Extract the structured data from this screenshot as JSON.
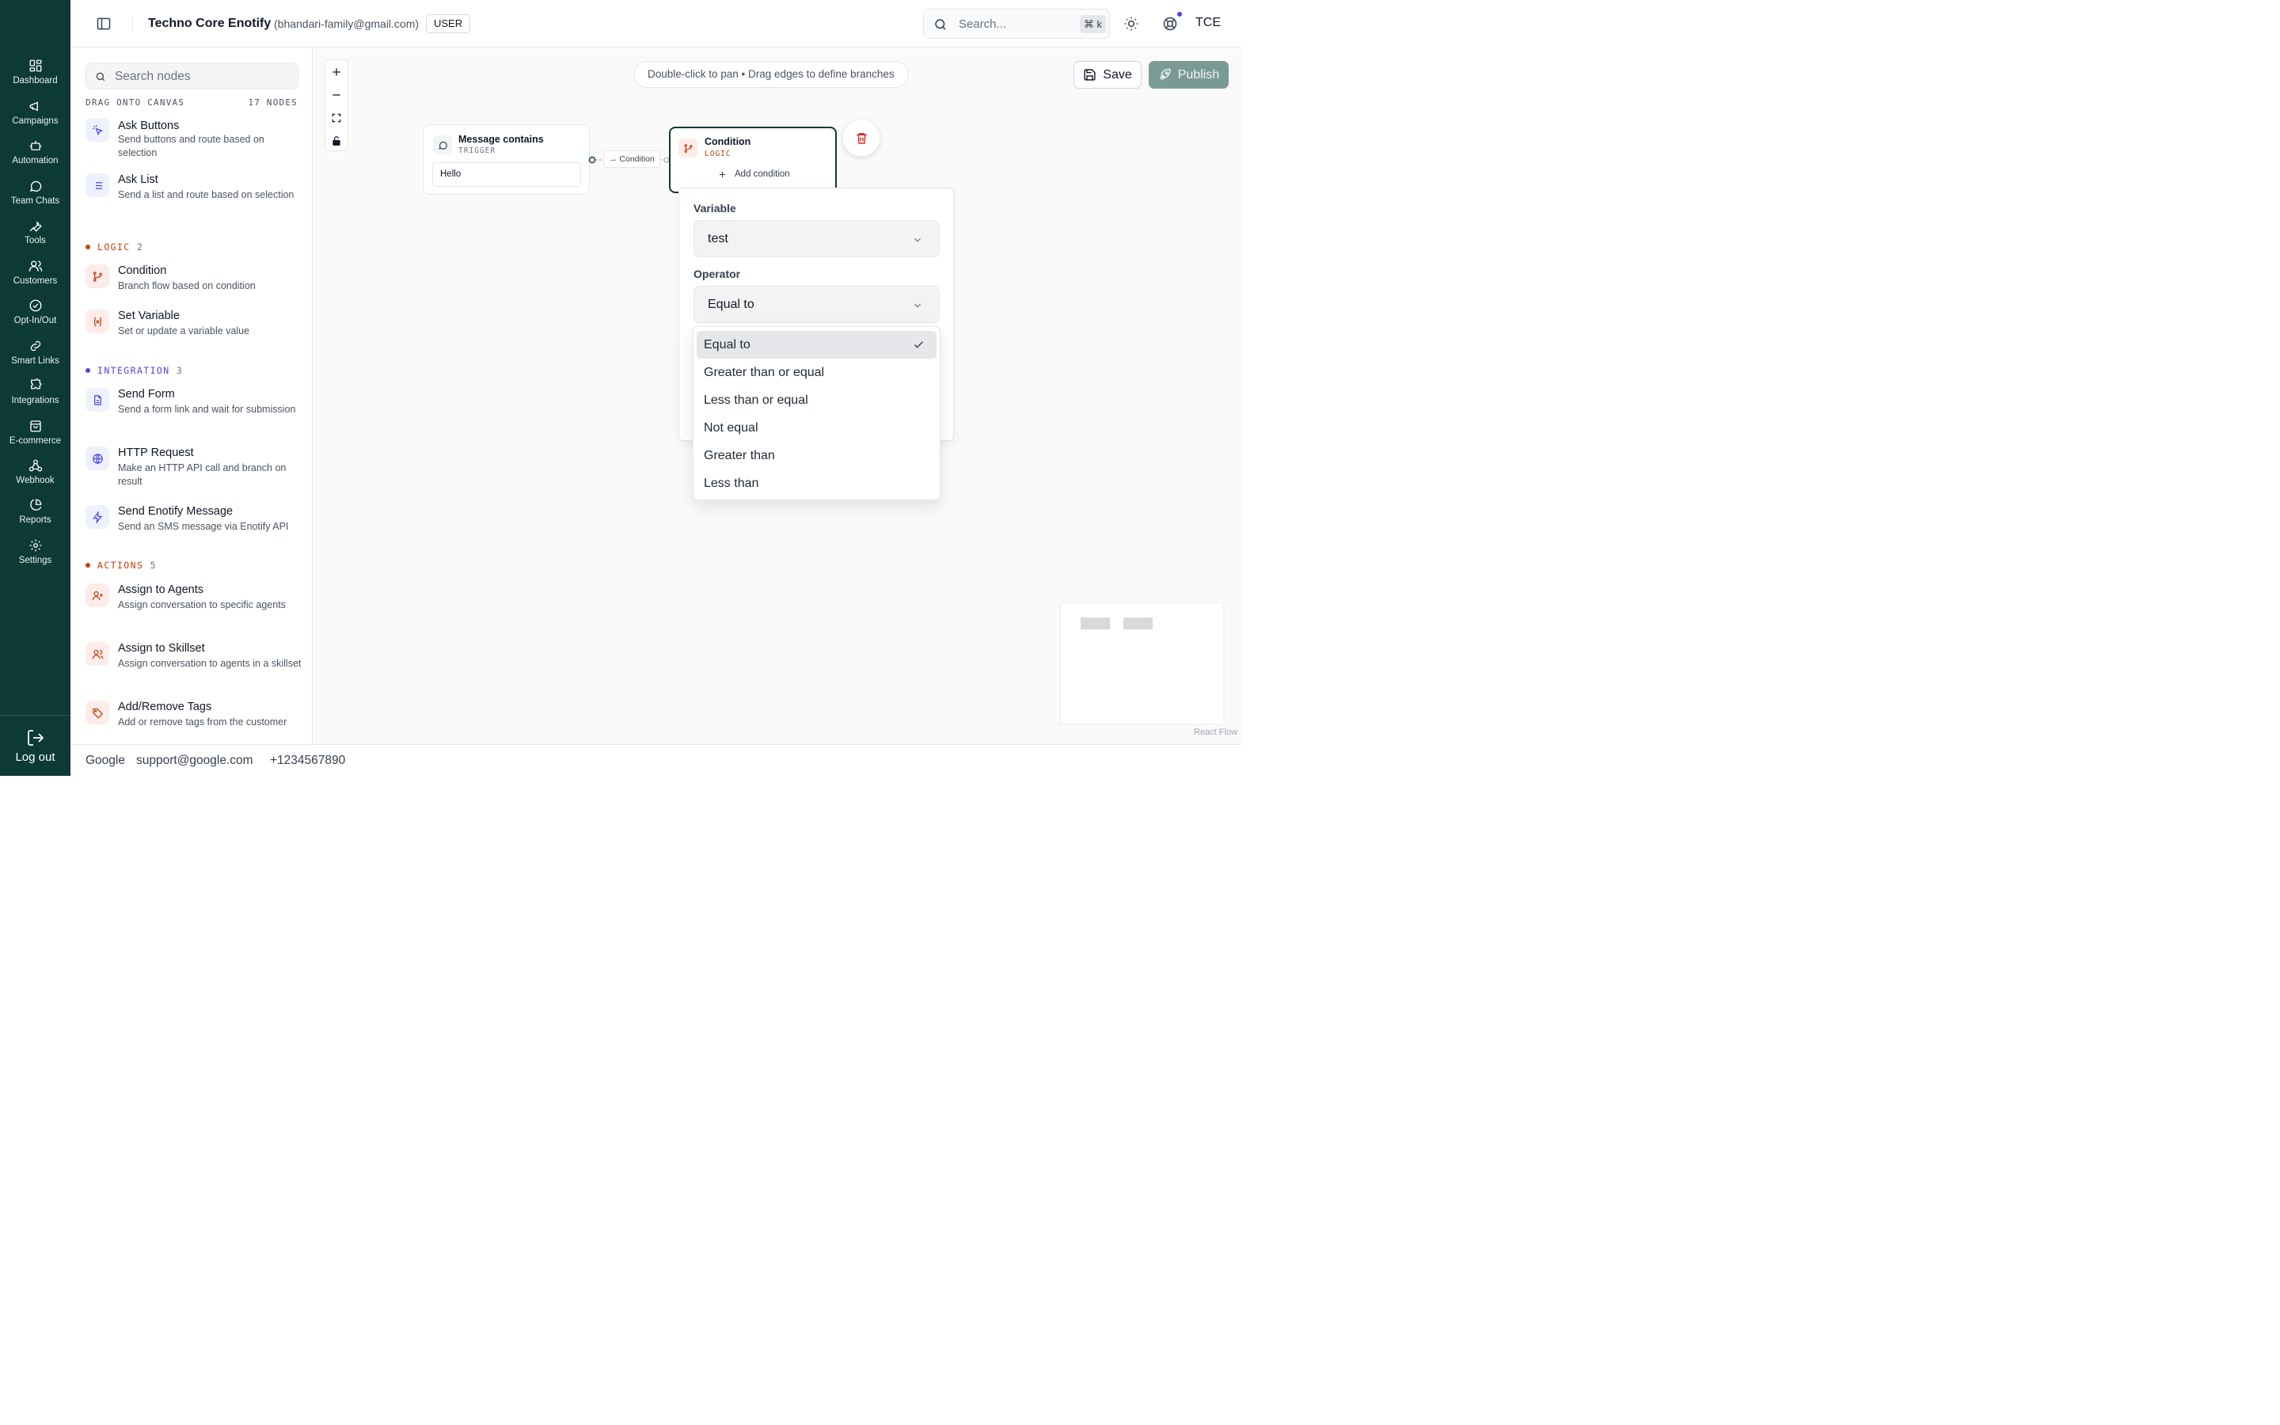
{
  "nav": {
    "items": [
      {
        "label": "Dashboard",
        "icon": "dashboard-icon"
      },
      {
        "label": "Campaigns",
        "icon": "megaphone-icon"
      },
      {
        "label": "Automation",
        "icon": "bot-icon"
      },
      {
        "label": "Team Chats",
        "icon": "chat-icon"
      },
      {
        "label": "Tools",
        "icon": "wrench-icon"
      },
      {
        "label": "Customers",
        "icon": "users-icon"
      },
      {
        "label": "Opt-In/Out",
        "icon": "check-circle-icon"
      },
      {
        "label": "Smart Links",
        "icon": "link-icon"
      },
      {
        "label": "Integrations",
        "icon": "puzzle-icon"
      },
      {
        "label": "E-commerce",
        "icon": "shopping-bag-icon"
      },
      {
        "label": "Webhook",
        "icon": "webhook-icon"
      },
      {
        "label": "Reports",
        "icon": "pie-chart-icon"
      },
      {
        "label": "Settings",
        "icon": "gear-icon"
      }
    ],
    "logout_label": "Log out"
  },
  "header": {
    "org_name": "Techno Core Enotify",
    "org_email": "(bhandari-family@gmail.com)",
    "role": "USER",
    "search_placeholder": "Search...",
    "search_shortcut": "⌘ k",
    "avatar_initials": "TCE"
  },
  "node_panel": {
    "search_placeholder": "Search nodes",
    "drag_hint": "DRAG ONTO CANVAS",
    "node_count": "17 NODES",
    "partial_items": [
      {
        "title": "Ask Buttons",
        "desc": "Send buttons and route based on selection"
      },
      {
        "title": "Ask List",
        "desc": "Send a list and route based on selection"
      }
    ],
    "sections": [
      {
        "title": "LOGIC",
        "count": "2",
        "color": "#c2410c",
        "items": [
          {
            "title": "Condition",
            "desc": "Branch flow based on condition"
          },
          {
            "title": "Set Variable",
            "desc": "Set or update a variable value"
          }
        ]
      },
      {
        "title": "INTEGRATION",
        "count": "3",
        "color": "#4f46e5",
        "items": [
          {
            "title": "Send Form",
            "desc": "Send a form link and wait for submission"
          },
          {
            "title": "HTTP Request",
            "desc": "Make an HTTP API call and branch on result"
          },
          {
            "title": "Send Enotify Message",
            "desc": "Send an SMS message via Enotify API"
          }
        ]
      },
      {
        "title": "ACTIONS",
        "count": "5",
        "color": "#c2410c",
        "items": [
          {
            "title": "Assign to Agents",
            "desc": "Assign conversation to specific agents"
          },
          {
            "title": "Assign to Skillset",
            "desc": "Assign conversation to agents in a skillset"
          },
          {
            "title": "Add/Remove Tags",
            "desc": "Add or remove tags from the customer"
          }
        ]
      }
    ]
  },
  "canvas": {
    "hint": "Double-click to pan • Drag edges to define branches",
    "save_label": "Save",
    "publish_label": "Publish",
    "trigger_node": {
      "title": "Message contains",
      "type": "TRIGGER",
      "value": "Hello"
    },
    "edge_label": "→ Condition",
    "condition_node": {
      "title": "Condition",
      "type": "LOGIC",
      "add_label": "Add condition"
    },
    "attribution": "React Flow"
  },
  "condition_editor": {
    "variable_label": "Variable",
    "variable_value": "test",
    "operator_label": "Operator",
    "operator_value": "Equal to",
    "operator_options": [
      "Equal to",
      "Greater than or equal",
      "Less than or equal",
      "Not equal",
      "Greater than",
      "Less than"
    ],
    "selected_index": 0
  },
  "footer": {
    "company": "Google",
    "email": "support@google.com",
    "phone": "+1234567890"
  },
  "colors": {
    "sidebar_bg": "#0d3a36",
    "publish_bg": "#7a9a96",
    "logic_accent": "#c2410c",
    "integration_accent": "#4f46e5"
  }
}
